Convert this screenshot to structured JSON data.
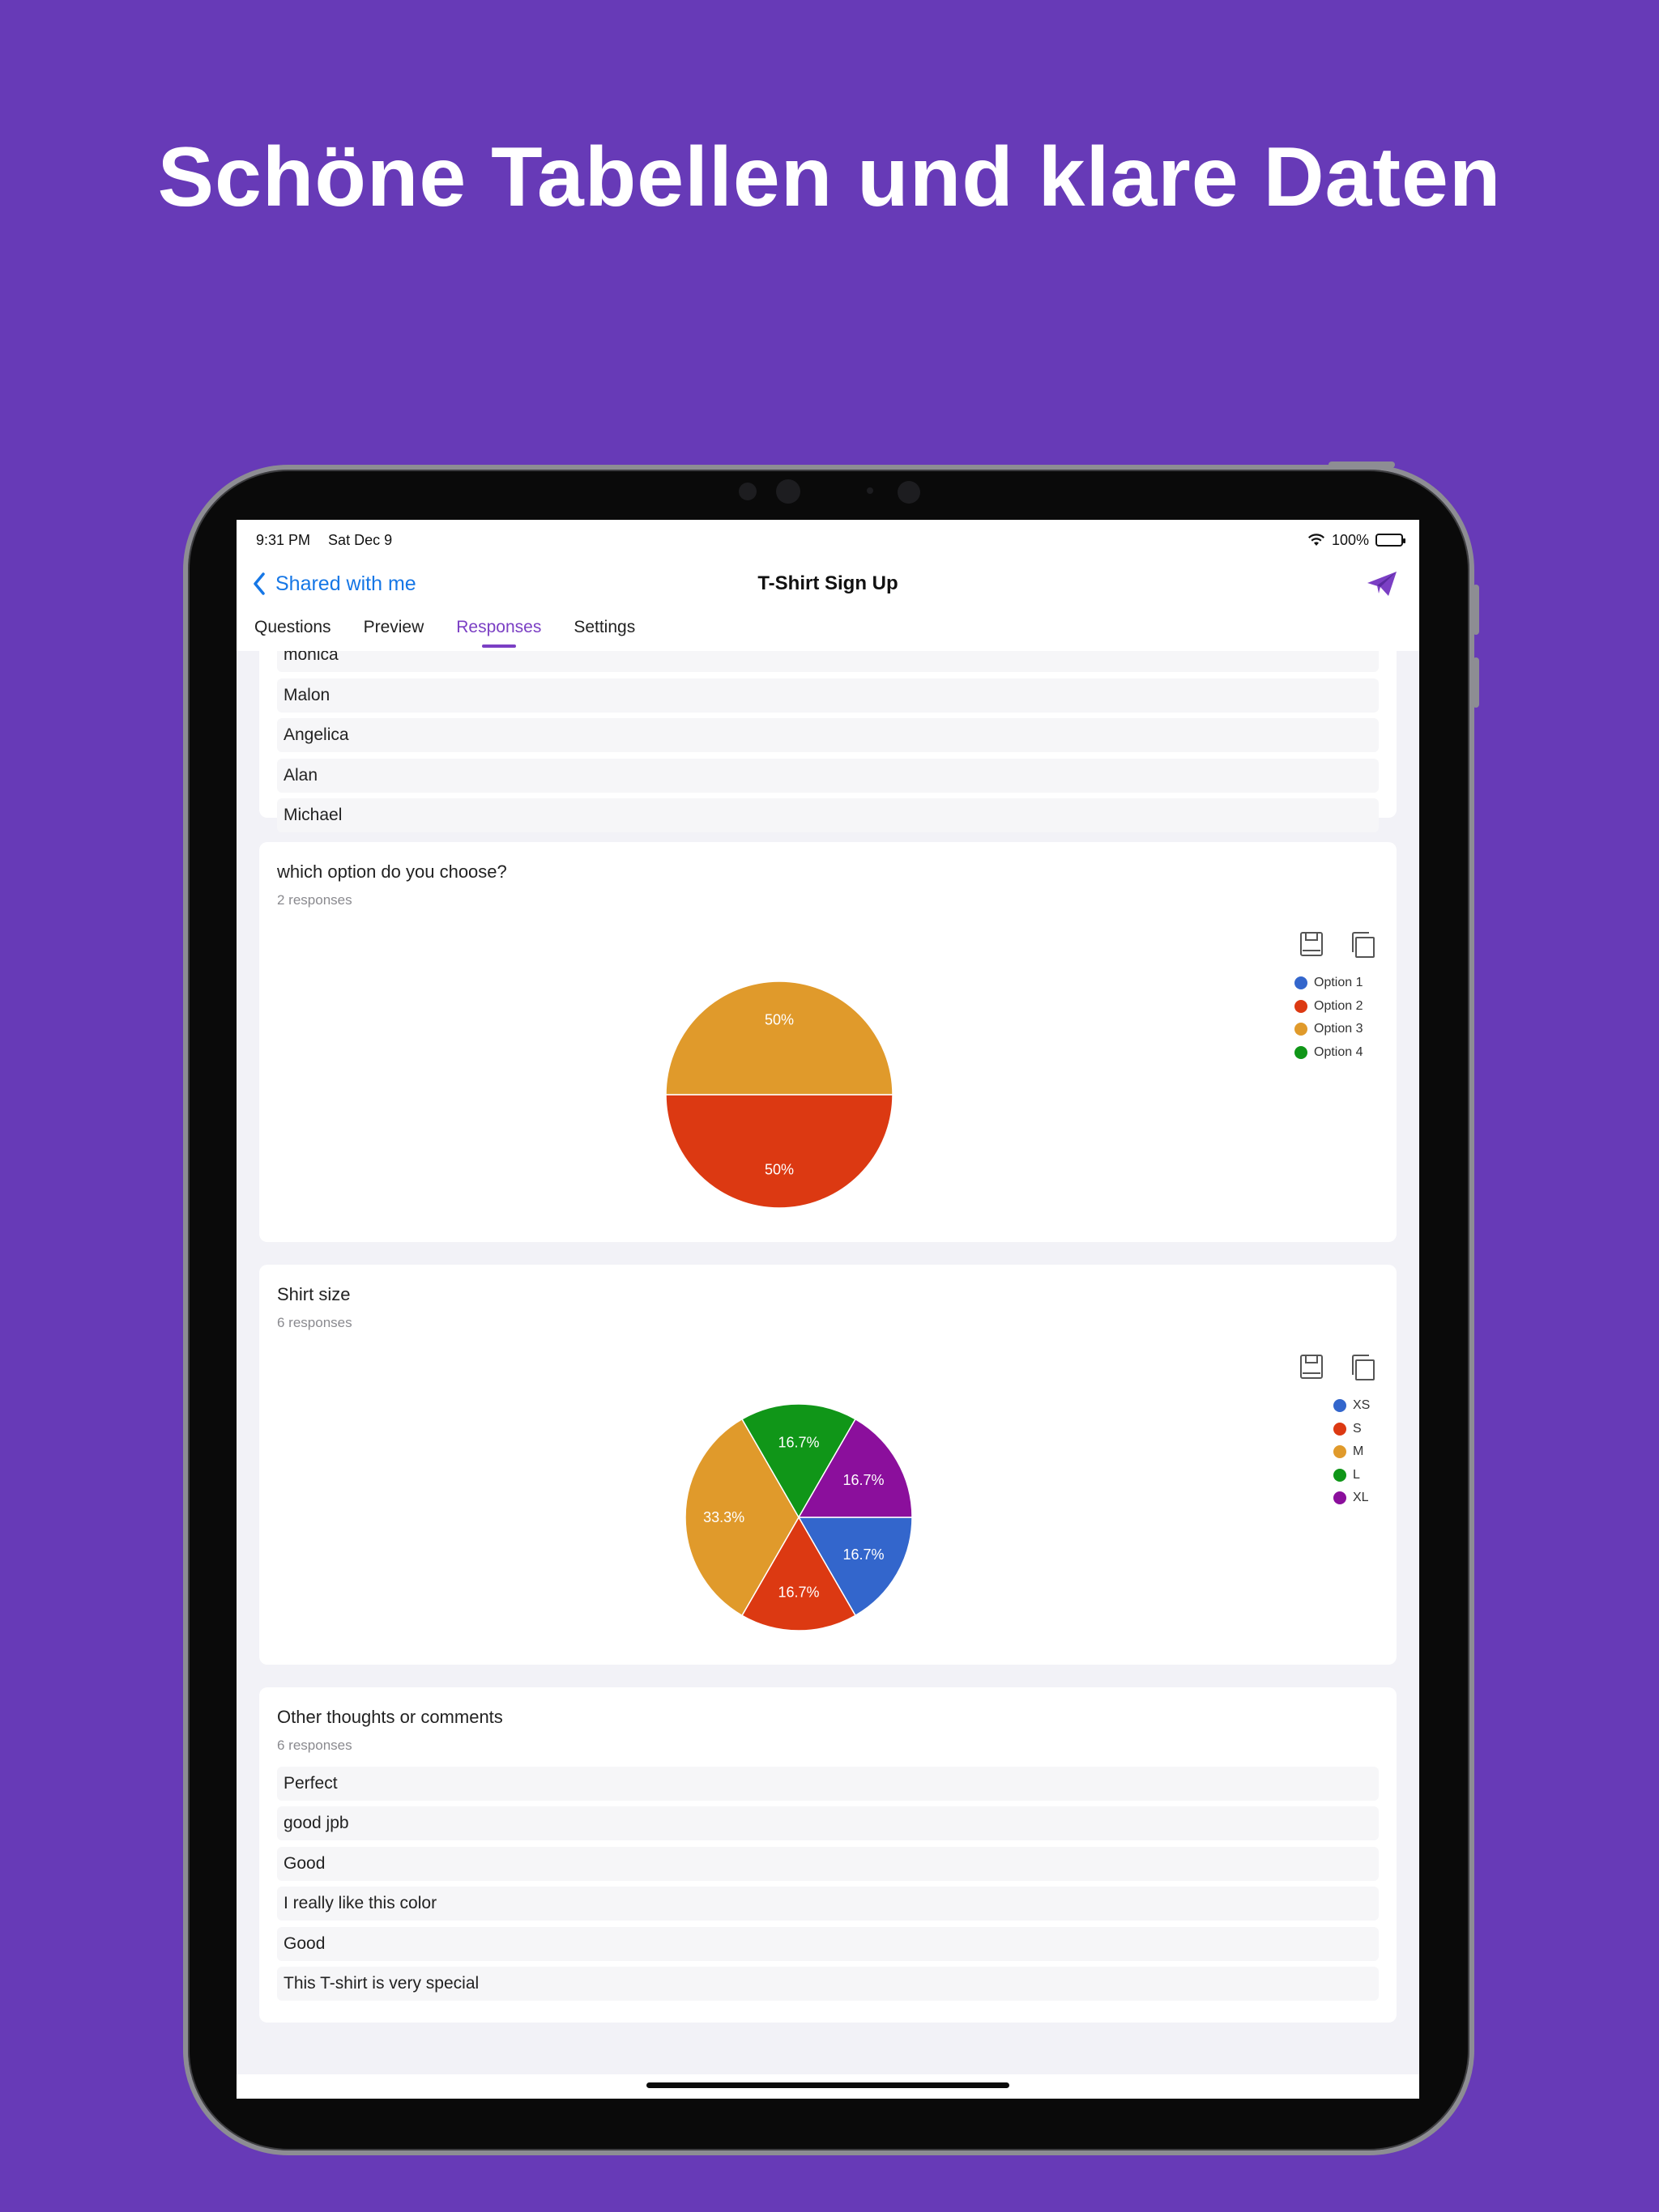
{
  "headline": "Schöne Tabellen und klare Daten",
  "status_bar": {
    "time": "9:31 PM",
    "date": "Sat Dec 9",
    "battery": "100%"
  },
  "nav": {
    "back_label": "Shared with me",
    "title": "T-Shirt Sign Up"
  },
  "tabs": [
    {
      "label": "Questions"
    },
    {
      "label": "Preview"
    },
    {
      "label": "Responses",
      "active": true
    },
    {
      "label": "Settings"
    }
  ],
  "names_card": {
    "rows": [
      "monica",
      "Malon",
      "Angelica",
      "Alan",
      "Michael"
    ]
  },
  "option_card": {
    "title": "which option do you choose?",
    "subtitle": "2 responses",
    "legend": [
      "Option 1",
      "Option 2",
      "Option 3",
      "Option 4"
    ]
  },
  "size_card": {
    "title": "Shirt size",
    "subtitle": "6 responses",
    "legend": [
      "XS",
      "S",
      "M",
      "L",
      "XL"
    ]
  },
  "comments_card": {
    "title": "Other thoughts or comments",
    "subtitle": "6 responses",
    "rows": [
      "Perfect",
      "good jpb",
      "Good",
      "I really like this color",
      "Good",
      "This T-shirt is very special"
    ]
  },
  "chart_data": [
    {
      "type": "pie",
      "title": "which option do you choose?",
      "categories": [
        "Option 1",
        "Option 2",
        "Option 3",
        "Option 4"
      ],
      "values": [
        0,
        1,
        1,
        0
      ],
      "labels": [
        "",
        "50%",
        "50%",
        ""
      ],
      "colors": [
        "#3366cc",
        "#dc3912",
        "#e09a2b",
        "#109618"
      ],
      "legend": "right"
    },
    {
      "type": "pie",
      "title": "Shirt size",
      "categories": [
        "XS",
        "S",
        "M",
        "L",
        "XL"
      ],
      "values": [
        1,
        1,
        2,
        1,
        1
      ],
      "labels": [
        "16.7%",
        "16.7%",
        "33.3%",
        "16.7%",
        "16.7%"
      ],
      "colors": [
        "#3366cc",
        "#dc3912",
        "#e09a2b",
        "#109618",
        "#8b0f9c"
      ],
      "legend": "right"
    }
  ],
  "colors": {
    "background": "#673ab7",
    "accent": "#7b3fc4",
    "link": "#1677e6"
  }
}
